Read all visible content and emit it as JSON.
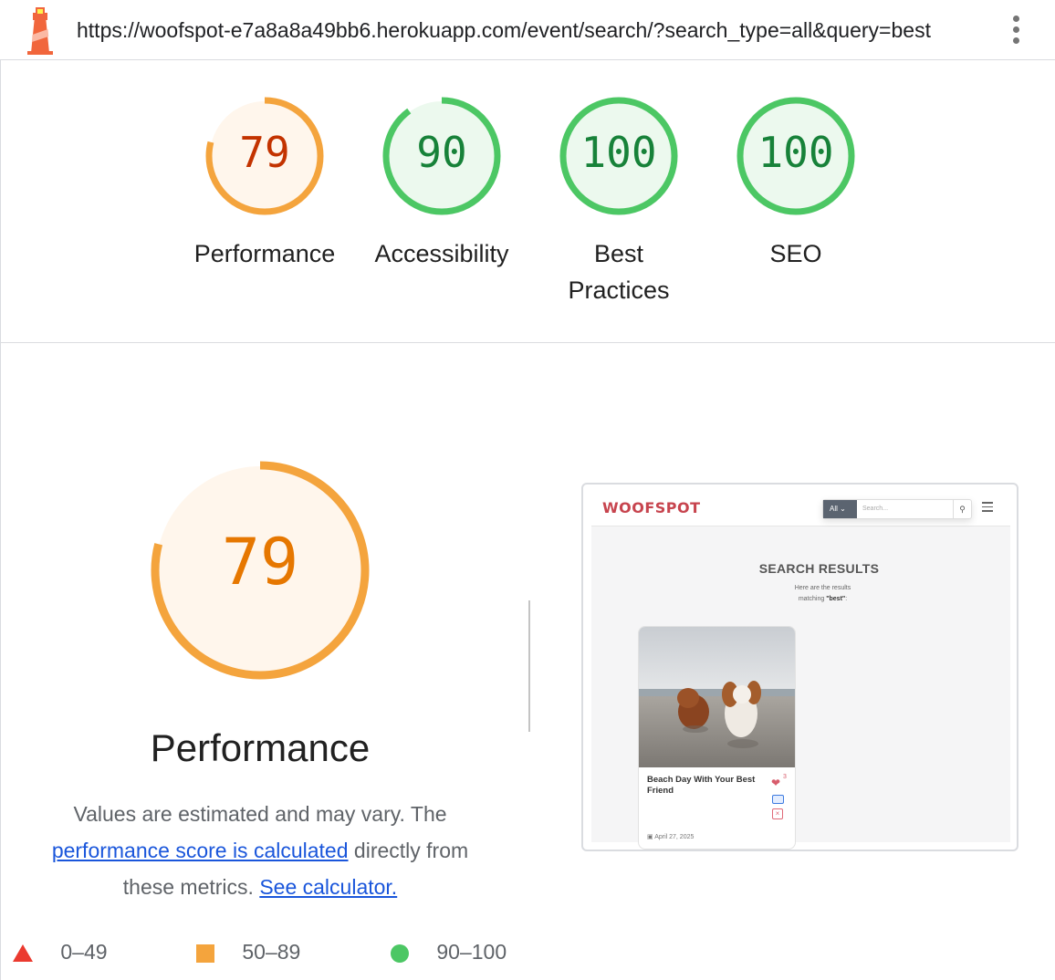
{
  "url": "https://woofspot-e7a8a8a49bb6.herokuapp.com/event/search/?search_type=all&query=best",
  "colors": {
    "orange": "#e67700",
    "orange_ring": "#f4a43d",
    "orange_bg": "#fff6ec",
    "green": "#178239",
    "green_ring": "#4cc764",
    "green_bg": "#ecf9ee",
    "red_text": "#c33300",
    "link": "#1a56db"
  },
  "gauges": [
    {
      "score": "79",
      "label": "Performance",
      "fraction": 0.79,
      "status": "average"
    },
    {
      "score": "90",
      "label": "Accessibility",
      "fraction": 0.9,
      "status": "pass"
    },
    {
      "score": "100",
      "label": "Best Practices",
      "fraction": 1.0,
      "status": "pass"
    },
    {
      "score": "100",
      "label": "SEO",
      "fraction": 1.0,
      "status": "pass"
    }
  ],
  "performance": {
    "score": "79",
    "fraction": 0.79,
    "title": "Performance",
    "desc_part1": "Values are estimated and may vary. The ",
    "desc_link1": "performance score is calculated",
    "desc_part2": " directly from these metrics. ",
    "desc_link2": "See calculator."
  },
  "legend": [
    {
      "shape": "triangle",
      "range": "0–49"
    },
    {
      "shape": "square",
      "range": "50–89"
    },
    {
      "shape": "circle",
      "range": "90–100"
    }
  ],
  "screenshot": {
    "logo": "WOOFSPOT",
    "search_type": "All",
    "search_placeholder": "Search...",
    "heading": "SEARCH RESULTS",
    "sub_line1": "Here are the results",
    "sub_line2_prefix": "matching ",
    "sub_query": "\"best\"",
    "sub_suffix": ":",
    "card_title": "Beach Day With Your Best Friend",
    "like_count": "3",
    "card_date": "April 27, 2025"
  },
  "icons": [
    "lighthouse-logo-icon",
    "more-vert-icon",
    "search-icon",
    "menu-icon",
    "heart-icon",
    "ticket-icon",
    "cancel-icon",
    "calendar-icon"
  ]
}
